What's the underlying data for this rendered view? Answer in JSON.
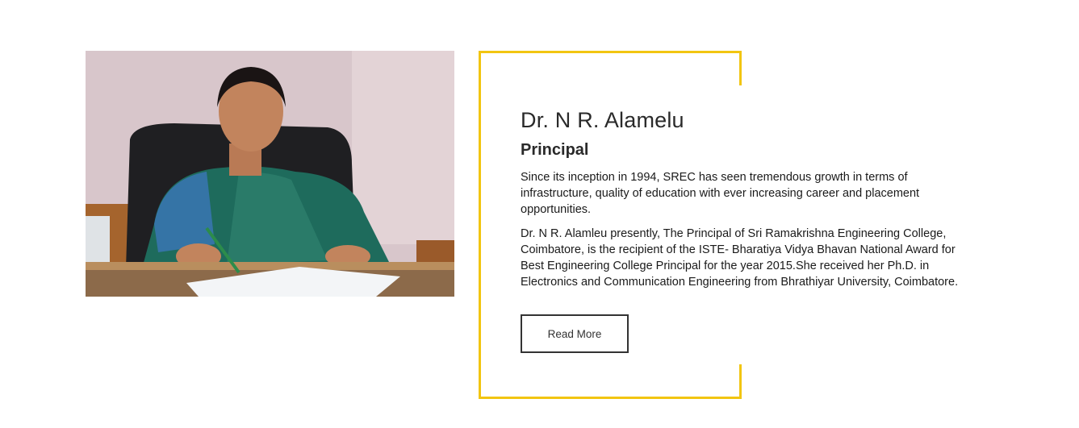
{
  "profile": {
    "name": "Dr. N R. Alamelu",
    "role": "Principal",
    "paragraphs": [
      "Since its inception in 1994, SREC has seen tremendous growth in terms of infrastructure, quality of education with ever increasing career and placement opportunities.",
      "Dr. N R. Alamleu presently, The Principal of Sri Ramakrishna Engineering College, Coimbatore, is the recipient of the ISTE- Bharatiya Vidya Bhavan National Award for Best Engineering College Principal for the year 2015.She received her Ph.D. in Electronics and Communication Engineering from Bhrathiyar University, Coimbatore."
    ],
    "read_more_label": "Read More"
  },
  "colors": {
    "accent": "#f2c511",
    "text": "#222222",
    "button_border": "#333333"
  }
}
